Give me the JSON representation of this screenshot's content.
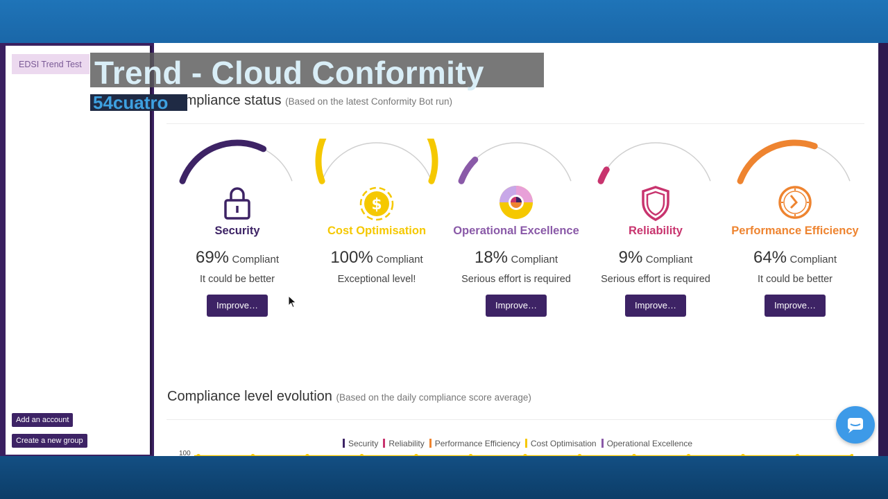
{
  "overlay": {
    "title": "Trend - Cloud Conformity",
    "brand": "54cuatro"
  },
  "sidebar": {
    "selected_item": "EDSI Trend Test",
    "add_account": "Add an account",
    "create_group": "Create a new group"
  },
  "compliance_status": {
    "title": "Compliance status",
    "subtitle": "(Based on the latest Conformity Bot run)",
    "compliant_label": "Compliant",
    "pillars": [
      {
        "name": "Security",
        "percent_text": "69%",
        "percent": 69,
        "message": "It could be better",
        "button": "Improve…",
        "color": "#3d2365",
        "icon": "lock-icon"
      },
      {
        "name": "Cost Optimisation",
        "percent_text": "100%",
        "percent": 100,
        "message": "Exceptional level!",
        "button": "",
        "color": "#f5c800",
        "icon": "dollar-coin-icon"
      },
      {
        "name": "Operational Excellence",
        "percent_text": "18%",
        "percent": 18,
        "message": "Serious effort is required",
        "button": "Improve…",
        "color": "#8a5aa8",
        "icon": "pie-target-icon"
      },
      {
        "name": "Reliability",
        "percent_text": "9%",
        "percent": 9,
        "message": "Serious effort is required",
        "button": "Improve…",
        "color": "#c8346e",
        "icon": "shield-icon"
      },
      {
        "name": "Performance Efficiency",
        "percent_text": "64%",
        "percent": 64,
        "message": "It could be better",
        "button": "Improve…",
        "color": "#ee8430",
        "icon": "clock-icon"
      }
    ]
  },
  "evolution": {
    "title": "Compliance level evolution",
    "subtitle": "(Based on the daily compliance score average)",
    "y_tick_top": "100",
    "legend": [
      {
        "label": "Security",
        "color": "#3d2365"
      },
      {
        "label": "Reliability",
        "color": "#c8346e"
      },
      {
        "label": "Performance Efficiency",
        "color": "#ee8430"
      },
      {
        "label": "Cost Optimisation",
        "color": "#f5c800"
      },
      {
        "label": "Operational Excellence",
        "color": "#8a5aa8"
      }
    ]
  },
  "chat": {
    "icon": "chat-bubble-icon"
  }
}
